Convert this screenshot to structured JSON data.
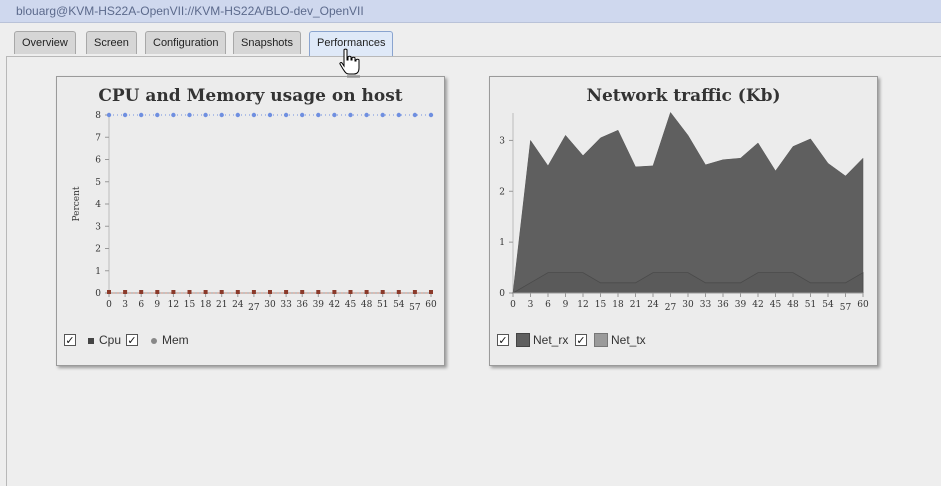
{
  "window": {
    "title": "blouarg@KVM-HS22A-OpenVII://KVM-HS22A/BLO-dev_OpenVII"
  },
  "tabs": [
    {
      "label": "Overview",
      "active": false
    },
    {
      "label": "Screen",
      "active": false
    },
    {
      "label": "Configuration",
      "active": false
    },
    {
      "label": "Snapshots",
      "active": false
    },
    {
      "label": "Performances",
      "active": true
    }
  ],
  "cpu_chart": {
    "title": "CPU and Memory usage on host",
    "ylabel": "Percent",
    "legend": [
      {
        "label": "Cpu",
        "checked": true,
        "color": "#8b3a2a",
        "marker": "square"
      },
      {
        "label": "Mem",
        "checked": true,
        "color": "#777777",
        "marker": "circle"
      }
    ]
  },
  "net_chart": {
    "title": "Network traffic (Kb)",
    "legend": [
      {
        "label": "Net_rx",
        "checked": true,
        "color": "#5f5f5f"
      },
      {
        "label": "Net_tx",
        "checked": true,
        "color": "#9a9a9a"
      }
    ]
  },
  "chart_data": [
    {
      "type": "line",
      "title": "CPU and Memory usage on host",
      "xlabel": "",
      "ylabel": "Percent",
      "x": [
        0,
        3,
        6,
        9,
        12,
        15,
        18,
        21,
        24,
        27,
        30,
        33,
        36,
        39,
        42,
        45,
        48,
        51,
        54,
        57,
        60
      ],
      "xticks": [
        "0",
        "3",
        "6",
        "9",
        "12",
        "15",
        "18",
        "21",
        "24",
        "27",
        "30",
        "33",
        "36",
        "39",
        "42",
        "45",
        "48",
        "51",
        "54",
        "57",
        "60"
      ],
      "yticks": [
        "0",
        "1",
        "2",
        "3",
        "4",
        "5",
        "6",
        "7",
        "8"
      ],
      "ylim": [
        0,
        8
      ],
      "series": [
        {
          "name": "Cpu",
          "color": "#8b3a2a",
          "values": [
            0,
            0,
            0,
            0,
            0,
            0,
            0,
            0,
            0,
            0,
            0,
            0,
            0,
            0,
            0,
            0,
            0,
            0,
            0,
            0,
            0
          ]
        },
        {
          "name": "Mem",
          "color": "#6f8fe0",
          "values": [
            8,
            8,
            8,
            8,
            8,
            8,
            8,
            8,
            8,
            8,
            8,
            8,
            8,
            8,
            8,
            8,
            8,
            8,
            8,
            8,
            8
          ]
        }
      ],
      "legend_position": "bottom-left"
    },
    {
      "type": "area",
      "title": "Network traffic (Kb)",
      "xlabel": "",
      "ylabel": "",
      "x": [
        0,
        3,
        6,
        9,
        12,
        15,
        18,
        21,
        24,
        27,
        30,
        33,
        36,
        39,
        42,
        45,
        48,
        51,
        54,
        57,
        60
      ],
      "xticks": [
        "0",
        "3",
        "6",
        "9",
        "12",
        "15",
        "18",
        "21",
        "24",
        "27",
        "30",
        "33",
        "36",
        "39",
        "42",
        "45",
        "48",
        "51",
        "54",
        "57",
        "60"
      ],
      "yticks": [
        "0",
        "1",
        "2",
        "3"
      ],
      "ylim": [
        0,
        3.5
      ],
      "series": [
        {
          "name": "Net_rx",
          "color": "#5f5f5f",
          "values": [
            0,
            3.0,
            2.5,
            3.1,
            2.7,
            3.05,
            3.2,
            2.48,
            2.5,
            3.55,
            3.1,
            2.52,
            2.62,
            2.65,
            2.95,
            2.4,
            2.88,
            3.03,
            2.55,
            2.3,
            2.65
          ]
        },
        {
          "name": "Net_tx",
          "color": "#9a9a9a",
          "values": [
            0,
            0.2,
            0.4,
            0.4,
            0.4,
            0.2,
            0.2,
            0.2,
            0.4,
            0.4,
            0.4,
            0.2,
            0.2,
            0.2,
            0.4,
            0.4,
            0.4,
            0.2,
            0.2,
            0.2,
            0.4
          ]
        }
      ],
      "legend_position": "bottom-left"
    }
  ]
}
